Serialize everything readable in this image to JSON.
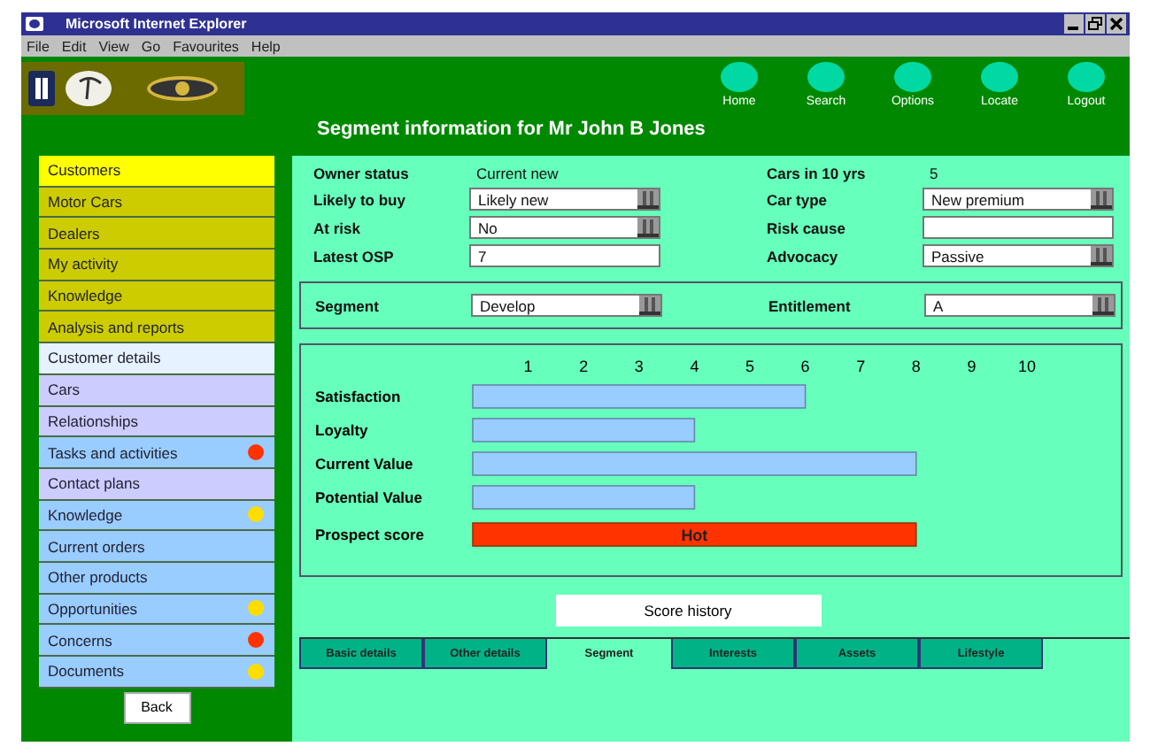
{
  "window": {
    "title": "Microsoft Internet Explorer"
  },
  "menu": [
    "File",
    "Edit",
    "View",
    "Go",
    "Favourites",
    "Help"
  ],
  "nav_buttons": [
    "Home",
    "Search",
    "Options",
    "Locate",
    "Logout"
  ],
  "page_title": "Segment information for Mr John B Jones",
  "sidebar": {
    "items": [
      {
        "label": "Customers",
        "kind": "section",
        "selected": true
      },
      {
        "label": "Motor Cars",
        "kind": "section",
        "selected": false
      },
      {
        "label": "Dealers",
        "kind": "section",
        "selected": false
      },
      {
        "label": "My activity",
        "kind": "section",
        "selected": false
      },
      {
        "label": "Knowledge",
        "kind": "section",
        "selected": false
      },
      {
        "label": "Analysis and reports",
        "kind": "section",
        "selected": false
      },
      {
        "label": "Customer details",
        "kind": "profile",
        "selected": true
      },
      {
        "label": "Cars",
        "kind": "profile",
        "selected": false
      },
      {
        "label": "Relationships",
        "kind": "profile",
        "selected": false
      },
      {
        "label": "Tasks and activities",
        "kind": "activity",
        "selected": false,
        "color": "#ff3300"
      },
      {
        "label": "Contact plans",
        "kind": "profile",
        "selected": false
      },
      {
        "label": "Knowledge",
        "kind": "activity",
        "selected": false,
        "color": "#ffdd00"
      },
      {
        "label": "Current orders",
        "kind": "activity",
        "selected": false
      },
      {
        "label": "Other products",
        "kind": "activity",
        "selected": false
      },
      {
        "label": "Opportunities",
        "kind": "activity",
        "selected": false,
        "color": "#ffdd00"
      },
      {
        "label": "Concerns",
        "kind": "activity",
        "selected": false,
        "color": "#ff3300"
      },
      {
        "label": "Documents",
        "kind": "activity",
        "selected": false,
        "color": "#ffdd00"
      }
    ],
    "back_button": "Back"
  },
  "fields": [
    {
      "label": "Owner status",
      "kind": "text",
      "value": "Current new"
    },
    {
      "label": "Cars in 10 yrs",
      "kind": "text",
      "value": "5"
    },
    {
      "label": "Likely to buy",
      "kind": "dropdown",
      "value": "Likely new"
    },
    {
      "label": "Car type",
      "kind": "dropdown",
      "value": "New premium"
    },
    {
      "label": "At risk",
      "kind": "dropdown",
      "value": "No"
    },
    {
      "label": "Risk cause",
      "kind": "input"
    },
    {
      "label": "Latest OSP",
      "kind": "input",
      "value": "7"
    },
    {
      "label": "Advocacy",
      "kind": "dropdown",
      "value": "Passive"
    }
  ],
  "segment_fields": [
    {
      "label": "Segment",
      "kind": "dropdown",
      "value": "Develop"
    },
    {
      "label": "Entitlement",
      "kind": "dropdown",
      "value": "A"
    }
  ],
  "scores": {
    "chart_data": {
      "type": "bar",
      "orientation": "horizontal",
      "categories": [
        "Satisfaction",
        "Loyalty",
        "Current Value",
        "Potential Value",
        "Prospect score"
      ],
      "series": [
        {
          "color": "#99ccff",
          "values": [
            6,
            4,
            8,
            4,
            null
          ]
        },
        {
          "color": "#ff3300",
          "values": [
            null,
            null,
            null,
            null,
            8
          ]
        }
      ],
      "xlim": [
        0,
        10
      ],
      "xticks": [
        1,
        2,
        3,
        4,
        5,
        6,
        7,
        8,
        9,
        10
      ],
      "annotations": [
        {
          "text": "Hot",
          "x": 4,
          "y": "Prospect score"
        }
      ]
    }
  },
  "score_history_button": "Score history",
  "tabs": [
    {
      "label": "Basic details",
      "selected": false
    },
    {
      "label": "Other details",
      "selected": false
    },
    {
      "label": "Segment",
      "selected": true
    },
    {
      "label": "Interests",
      "selected": false
    },
    {
      "label": "Assets",
      "selected": false
    },
    {
      "label": "Lifestyle",
      "selected": false
    }
  ]
}
